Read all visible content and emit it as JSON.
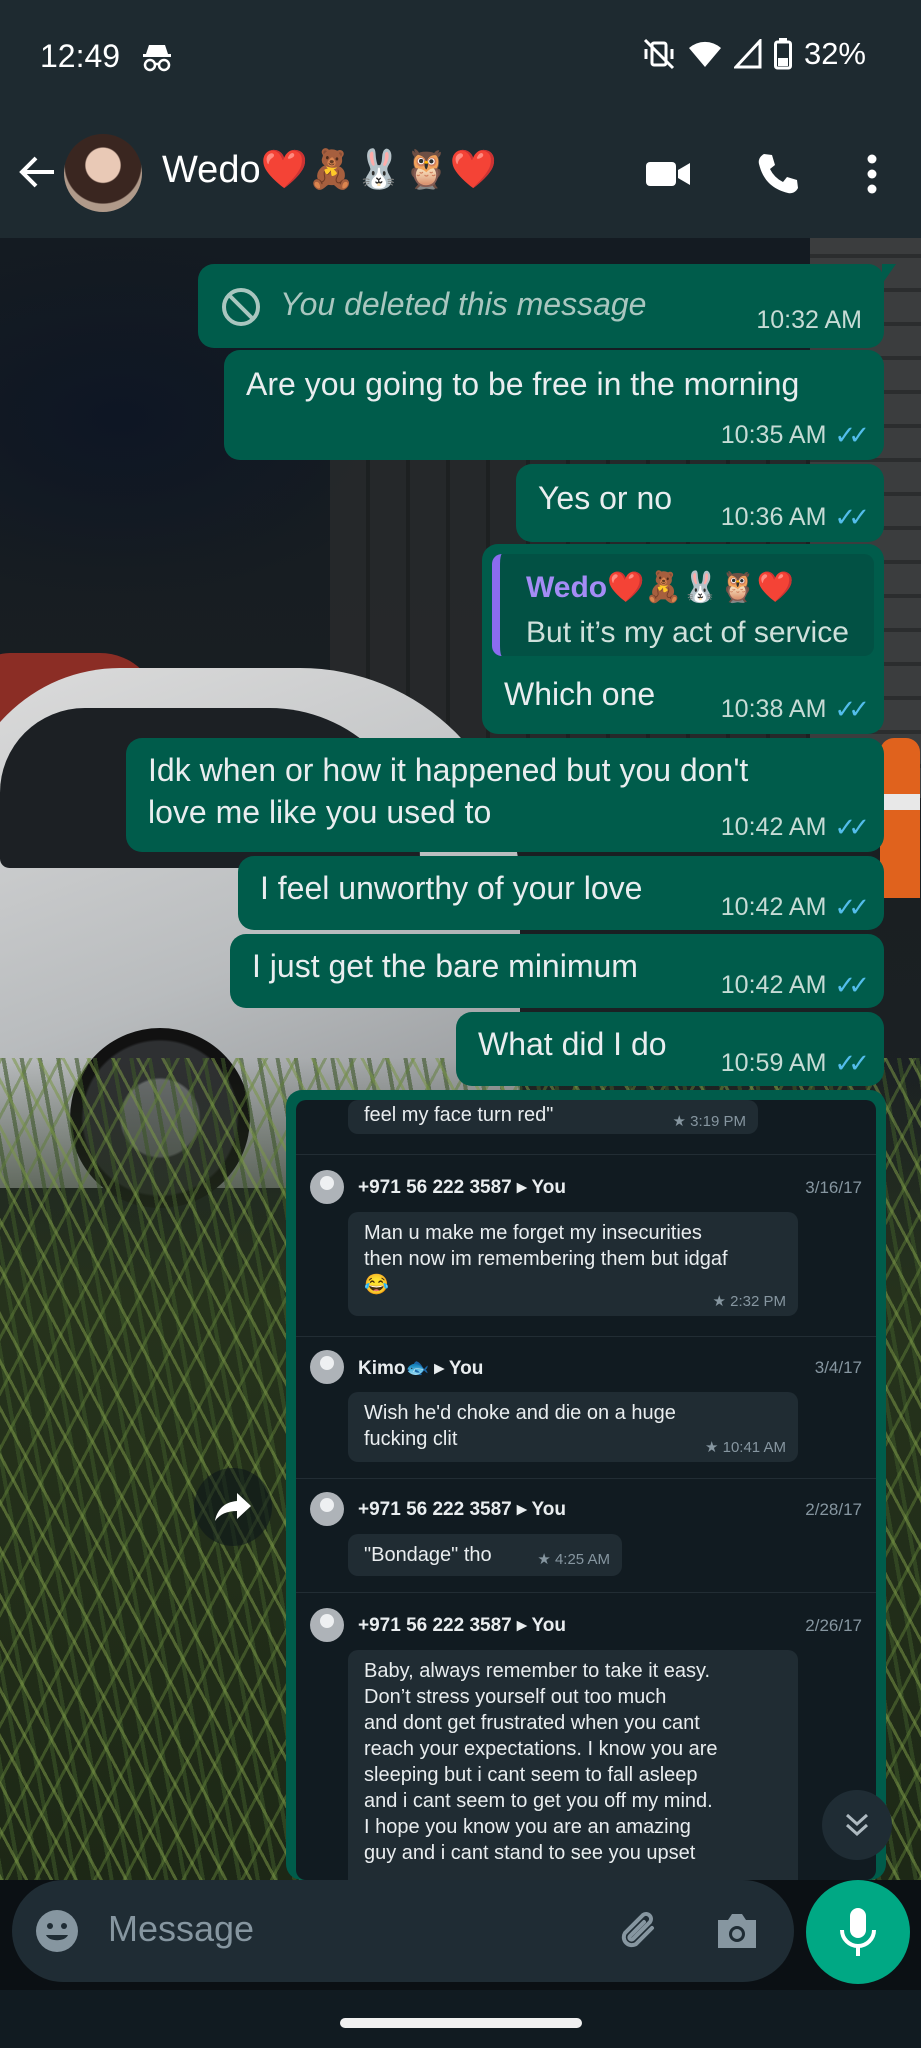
{
  "status_bar": {
    "time": "12:49",
    "battery": "32%",
    "icons": [
      "incognito-icon",
      "vibrate-off-icon",
      "wifi-icon",
      "signal-icon",
      "battery-icon"
    ]
  },
  "header": {
    "contact_name": "Wedo❤️🧸🐰🦉❤️",
    "icons": [
      "back-arrow-icon",
      "video-call-icon",
      "phone-icon",
      "more-vert-icon"
    ]
  },
  "messages": [
    {
      "text": "You deleted this message",
      "time": "10:32 AM",
      "deleted": true
    },
    {
      "text": "Are you going to be free in the morning",
      "time": "10:35 AM"
    },
    {
      "text": "Yes or no",
      "time": "10:36 AM"
    },
    {
      "text": "Which one",
      "time": "10:38 AM",
      "quote": {
        "name": "Wedo❤️🧸🐰🦉❤️",
        "text": "But it’s my act of service"
      }
    },
    {
      "text_line1": "Idk when or how it happened but you don't",
      "text_line2": "love me like you used to",
      "time": "10:42 AM"
    },
    {
      "text": "I feel unworthy of your love",
      "time": "10:42 AM"
    },
    {
      "text": "I just get the bare minimum",
      "time": "10:42 AM"
    },
    {
      "text": "What did I do",
      "time": "10:59 AM"
    }
  ],
  "screenshot": {
    "top_text": "feel my face turn red\"",
    "top_time": "★ 3:19 PM",
    "entries": [
      {
        "sender": "+971 56 222 3587 ▸ You",
        "date": "3/16/17",
        "text": "Man u make me forget my insecurities\nthen now im remembering them but idgaf\n😂",
        "time": "★ 2:32 PM"
      },
      {
        "sender": "Kimo🐟 ▸ You",
        "date": "3/4/17",
        "text": "Wish he'd choke and die on a huge\nfucking clit",
        "time": "★ 10:41 AM"
      },
      {
        "sender": "+971 56 222 3587 ▸ You",
        "date": "2/28/17",
        "text": "\"Bondage\" tho",
        "time": "★ 4:25 AM"
      },
      {
        "sender": "+971 56 222 3587 ▸ You",
        "date": "2/26/17",
        "text": "Baby, always remember to take it easy.\nDon’t stress yourself out too much\nand dont get frustrated when you cant\nreach your expectations. I know you are\nsleeping but i cant seem to fall asleep\nand i cant seem to get you off my mind.\nI hope you know you are an amazing\nguy and i cant stand to see you upset",
        "time": ""
      }
    ]
  },
  "composer": {
    "placeholder": "Message",
    "icons": [
      "emoji-icon",
      "attach-icon",
      "camera-icon",
      "mic-icon"
    ]
  },
  "colors": {
    "outgoing_bubble": "#005c4b",
    "header": "#1e2a30",
    "read_ticks": "#53bdeb",
    "mic_button": "#00a884"
  }
}
